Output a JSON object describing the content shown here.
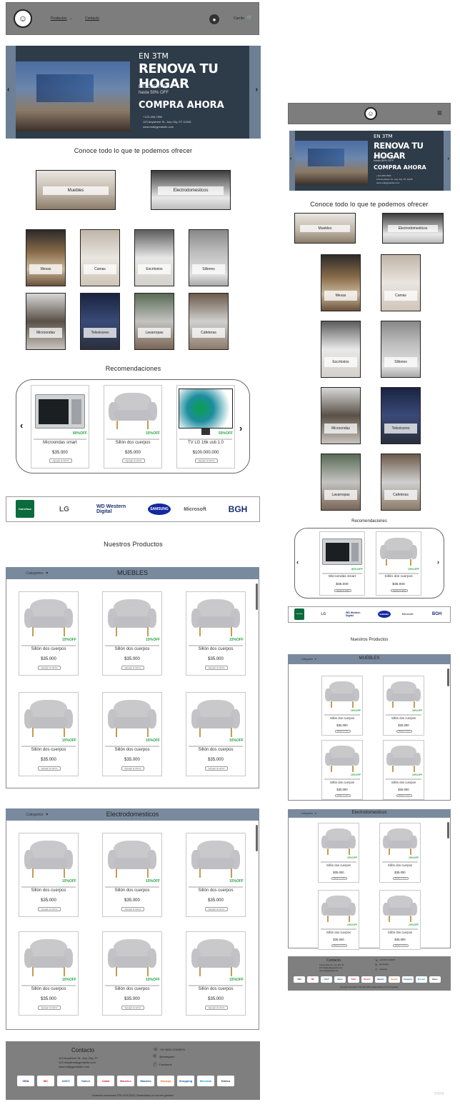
{
  "header": {
    "nav": [
      "Productos",
      "Contacto"
    ],
    "cart_label": "Carrito"
  },
  "hero": {
    "eyebrow": "EN 3TM",
    "headline": "RENOVA TU HOGAR",
    "discount_line1": "DESCUENTOS",
    "discount_line2": "hasta 50% OFF",
    "cta": "COMPRA AHORA",
    "phone": "+123-456-7890",
    "address": "123 Anywhere St., Any City, ST 12345",
    "website": "www.reallygreatsite.com"
  },
  "offer_title": "Conoce todo lo que te podemos ofrecer",
  "main_categories": [
    "Muebles",
    "Electrodomesticos"
  ],
  "sub_categories": [
    "Mesas",
    "Camas",
    "Escritorios",
    "Sillones",
    "Microondas",
    "Televisores",
    "Lavarropas",
    "Cafeteras"
  ],
  "recommendations": {
    "title": "Recomendaciones",
    "items": [
      {
        "name": "Microondas smart",
        "discount": "80%OFF",
        "price": "$35.000",
        "button": "Agregar al carrito",
        "kind": "microwave"
      },
      {
        "name": "Sillón dos cuerpos",
        "discount": "15%OFF",
        "price": "$35.000",
        "button": "Agregar al carrito",
        "kind": "sofa"
      },
      {
        "name": "TV LG 16k usb 1.0",
        "discount": "50%OFF",
        "price": "$100.000.000",
        "button": "Agregar al carrito",
        "kind": "tv"
      }
    ],
    "mobile_items": [
      {
        "name": "Microondas smart",
        "discount": "80%OFF",
        "price": "$35.000",
        "button": "Agregar al carrito",
        "kind": "microwave"
      },
      {
        "name": "Sillón dos cuerpos",
        "discount": "15%OFF",
        "price": "$35.000",
        "button": "Agregar al carrito",
        "kind": "sofa"
      }
    ]
  },
  "brands": [
    "Carrefour",
    "LG",
    "WD Western Digital",
    "SAMSUNG",
    "Microsoft",
    "BGH"
  ],
  "products_title": "Nuestros Productos",
  "panels": [
    {
      "categories_label": "Categories",
      "title": "MUEBLES"
    },
    {
      "categories_label": "Categories",
      "title": "Electrodomesticos"
    }
  ],
  "product": {
    "name": "Sillón dos cuerpos",
    "discount": "15%OFF",
    "price": "$35.000",
    "button": "Agregar al carrito"
  },
  "footer": {
    "contact_title": "Contacto",
    "address": "123 Anywhere St., Any City, ST",
    "email": "123 info@reallygreatsite.com",
    "website": "www.reallygreatsite.com",
    "phone": "+54 3583 12349876",
    "instagram": "@instagram",
    "facebook": "Facebook",
    "payments": [
      "VISA",
      "MC",
      "AMEX",
      "Nativa",
      "Cabal",
      "Banelco",
      "Maestro",
      "Naranja",
      "Shopping",
      "Mercado",
      "Diners"
    ],
    "copyright": "Derechos reservados 3TM 2023-2024 | Desarrollado por los tres grandes"
  },
  "watermark": "miro"
}
